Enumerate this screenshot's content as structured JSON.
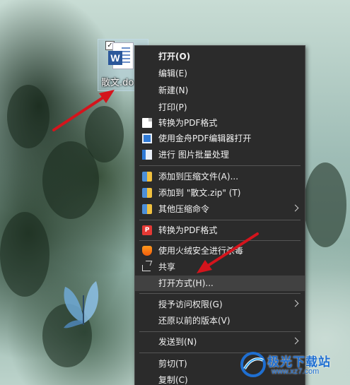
{
  "desktop": {
    "file": {
      "name": "散文.do",
      "app_badge": "W",
      "checkbox": "✓"
    }
  },
  "context_menu": {
    "items": [
      {
        "label": "打开(O)",
        "icon": ""
      },
      {
        "label": "编辑(E)",
        "icon": ""
      },
      {
        "label": "新建(N)",
        "icon": ""
      },
      {
        "label": "打印(P)",
        "icon": ""
      },
      {
        "label": "转换为PDF格式",
        "icon": "pdf-page-icon"
      },
      {
        "label": "使用金舟PDF编辑器打开",
        "icon": "pdf-editor-icon"
      },
      {
        "label": "进行 图片批量处理",
        "icon": "image-batch-icon"
      },
      {
        "label": "添加到压缩文件(A)...",
        "icon": "archive-icon"
      },
      {
        "label": "添加到 \"散文.zip\" (T)",
        "icon": "archive-icon"
      },
      {
        "label": "其他压缩命令",
        "icon": "archive-icon"
      },
      {
        "label": "转换为PDF格式",
        "icon": "pdf-convert-icon"
      },
      {
        "label": "使用火绒安全进行杀毒",
        "icon": "shield-icon"
      },
      {
        "label": "共享",
        "icon": "share-icon"
      },
      {
        "label": "打开方式(H)...",
        "icon": ""
      },
      {
        "label": "授予访问权限(G)",
        "icon": ""
      },
      {
        "label": "还原以前的版本(V)",
        "icon": ""
      },
      {
        "label": "发送到(N)",
        "icon": ""
      },
      {
        "label": "剪切(T)",
        "icon": ""
      },
      {
        "label": "复制(C)",
        "icon": ""
      }
    ],
    "highlighted_item": "打开方式(H)...",
    "pdf_convert_badge": "P"
  },
  "watermark": {
    "name": "极光下载站",
    "url": "www.xz7.com"
  },
  "colors": {
    "menu_bg": "#2b2b2b",
    "menu_highlight": "#414141",
    "menu_text": "#f2f2f2",
    "arrow": "#d4141c",
    "watermark": "#1f6fd1"
  }
}
